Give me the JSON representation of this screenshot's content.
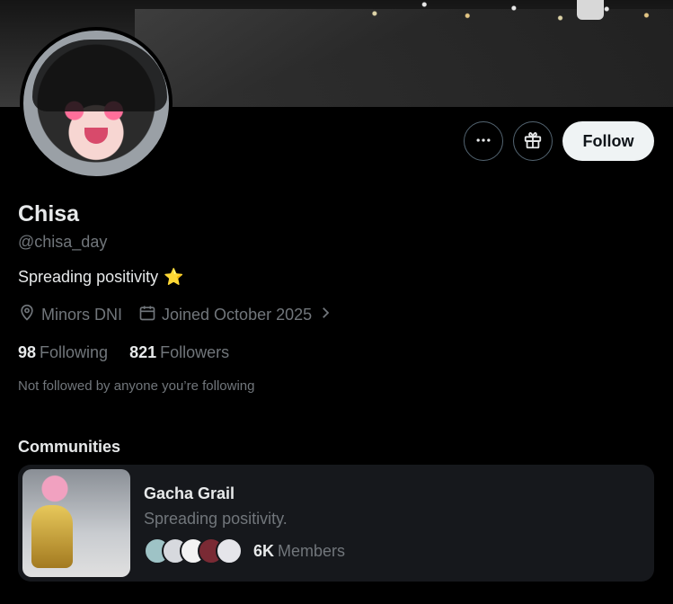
{
  "profile": {
    "name": "Chisa",
    "handle": "@chisa_day",
    "bio": "Spreading positivity",
    "bio_emoji": "⭐",
    "location": "Minors DNI",
    "joined": "Joined October 2025",
    "following_count": "98",
    "following_label": "Following",
    "followers_count": "821",
    "followers_label": "Followers",
    "not_followed_text": "Not followed by anyone you’re following"
  },
  "actions": {
    "more_icon": "more-horizontal-icon",
    "gift_icon": "gift-icon",
    "follow_label": "Follow"
  },
  "communities": {
    "title": "Communities",
    "items": [
      {
        "name": "Gacha Grail",
        "description": "Spreading positivity.",
        "members_count": "6K",
        "members_label": "Members"
      }
    ]
  },
  "colors": {
    "background": "#000000",
    "text_primary": "#e7e9ea",
    "text_secondary": "#71767b",
    "card_background": "#16181c",
    "follow_button": "#eff3f4",
    "star": "#f5a623"
  }
}
